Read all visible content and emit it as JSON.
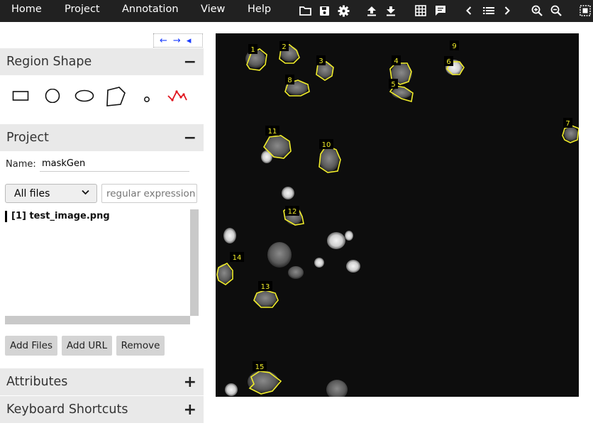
{
  "menu": {
    "home": "Home",
    "project": "Project",
    "annotation": "Annotation",
    "view": "View",
    "help": "Help"
  },
  "toolbar_icons": [
    "folder-open-icon",
    "save-icon",
    "settings-icon",
    "upload-icon",
    "download-icon",
    "grid-icon",
    "comment-icon",
    "prev-icon",
    "list-icon",
    "next-icon",
    "zoom-in-icon",
    "zoom-out-icon",
    "select-region-icon"
  ],
  "nav_arrows": {
    "left": "←",
    "right": "→",
    "collapse": "◂"
  },
  "region_shape": {
    "title": "Region Shape",
    "toggle": "−",
    "shapes": [
      "rectangle",
      "circle",
      "ellipse",
      "polygon",
      "point",
      "polyline"
    ],
    "active_color": "#e0141e"
  },
  "project": {
    "title": "Project",
    "toggle": "−",
    "name_label": "Name:",
    "name_value": "maskGen",
    "filter_value": "All files",
    "regex_placeholder": "regular expression",
    "files": [
      "[1] test_image.png"
    ],
    "buttons": {
      "add_files": "Add Files",
      "add_url": "Add URL",
      "remove": "Remove"
    }
  },
  "attributes": {
    "title": "Attributes",
    "toggle": "+"
  },
  "keyboard_shortcuts": {
    "title": "Keyboard Shortcuts",
    "toggle": "+"
  },
  "regions": {
    "stroke_color": "#f2ee2a",
    "labels": [
      "1",
      "2",
      "3",
      "4",
      "5",
      "6",
      "7",
      "8",
      "9",
      "10",
      "11",
      "12",
      "13",
      "14",
      "15"
    ]
  }
}
